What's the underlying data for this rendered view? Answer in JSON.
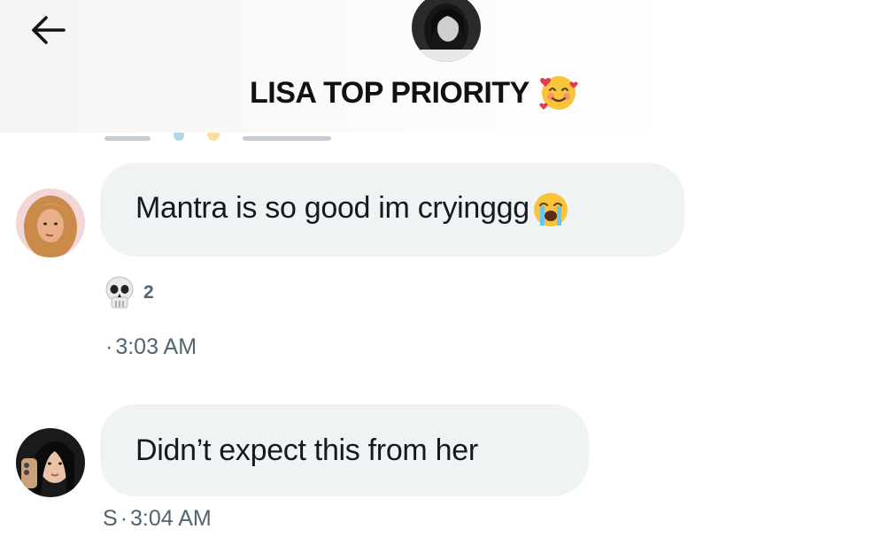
{
  "header": {
    "back_icon": "arrow-left-icon",
    "group_avatar_icon": "group-avatar",
    "title": "LISA TOP PRIORITY",
    "title_emoji": "smiling-face-with-hearts-emoji"
  },
  "messages": [
    {
      "avatar_icon": "user-avatar-blonde",
      "text": "Mantra is so good im cryinggg",
      "emoji": "loudly-crying-face-emoji",
      "reaction": {
        "emoji": "skull-emoji",
        "count": "2"
      },
      "sender": "",
      "separator": "·",
      "time": "3:03 AM"
    },
    {
      "avatar_icon": "user-avatar-dark-hair",
      "text": "Didn’t expect this from her",
      "sender": "S",
      "separator": "·",
      "time": "3:04 AM"
    }
  ],
  "colors": {
    "bubble_bg": "#eff3f4",
    "meta_text": "#536471",
    "body_text": "#0f1419"
  }
}
